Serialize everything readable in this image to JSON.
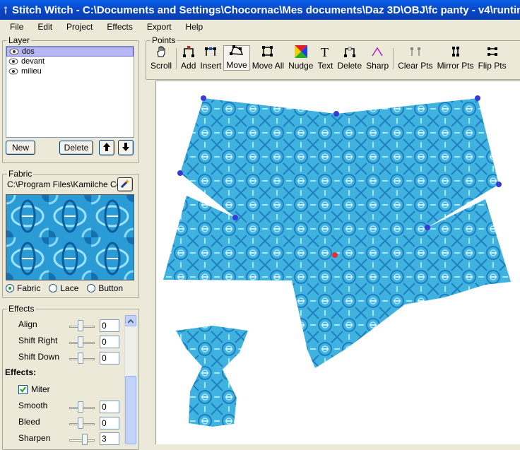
{
  "window": {
    "title": "Stitch Witch - C:\\Documents and Settings\\Chocornac\\Mes documents\\Daz 3D\\OBJ\\fc panty - v4\\runtime\\geometries\\"
  },
  "menu": [
    "File",
    "Edit",
    "Project",
    "Effects",
    "Export",
    "Help"
  ],
  "layer": {
    "legend": "Layer",
    "items": [
      {
        "label": "dos",
        "selected": true
      },
      {
        "label": "devant",
        "selected": false
      },
      {
        "label": "milieu",
        "selected": false
      }
    ],
    "new_label": "New",
    "delete_label": "Delete"
  },
  "fabric": {
    "legend": "Fabric",
    "path": "C:\\Program Files\\Kamilche Co",
    "options": [
      "Fabric",
      "Lace",
      "Button"
    ],
    "selected": "Fabric"
  },
  "effects": {
    "legend": "Effects",
    "align": {
      "label": "Align",
      "value": "0"
    },
    "shift_right": {
      "label": "Shift Right",
      "value": "0"
    },
    "shift_down": {
      "label": "Shift Down",
      "value": "0"
    },
    "section_label": "Effects:",
    "miter": {
      "label": "Miter",
      "checked": true
    },
    "smooth": {
      "label": "Smooth",
      "value": "0"
    },
    "bleed": {
      "label": "Bleed",
      "value": "0"
    },
    "sharpen": {
      "label": "Sharpen",
      "value": "3"
    }
  },
  "points": {
    "legend": "Points",
    "tools": [
      {
        "label": "Scroll",
        "icon": "hand-icon"
      },
      {
        "label": "Add",
        "icon": "add-point-icon"
      },
      {
        "label": "Insert",
        "icon": "insert-point-icon"
      },
      {
        "label": "Move",
        "icon": "move-point-icon",
        "active": true
      },
      {
        "label": "Move All",
        "icon": "move-all-icon"
      },
      {
        "label": "Nudge",
        "icon": "nudge-icon"
      },
      {
        "label": "Text",
        "icon": "text-icon"
      },
      {
        "label": "Delete",
        "icon": "delete-point-icon"
      },
      {
        "label": "Sharp",
        "icon": "sharp-icon"
      },
      {
        "label": "Clear Pts",
        "icon": "clear-points-icon"
      },
      {
        "label": "Mirror Pts",
        "icon": "mirror-points-icon"
      },
      {
        "label": "Flip Pts",
        "icon": "flip-points-icon"
      }
    ]
  },
  "colors": {
    "fabric_base": "#3FB2E0",
    "fabric_dark": "#1E7FBF",
    "point_blue": "#3A3AD8",
    "point_red": "#E03030",
    "title_bar": "#0845C6"
  }
}
